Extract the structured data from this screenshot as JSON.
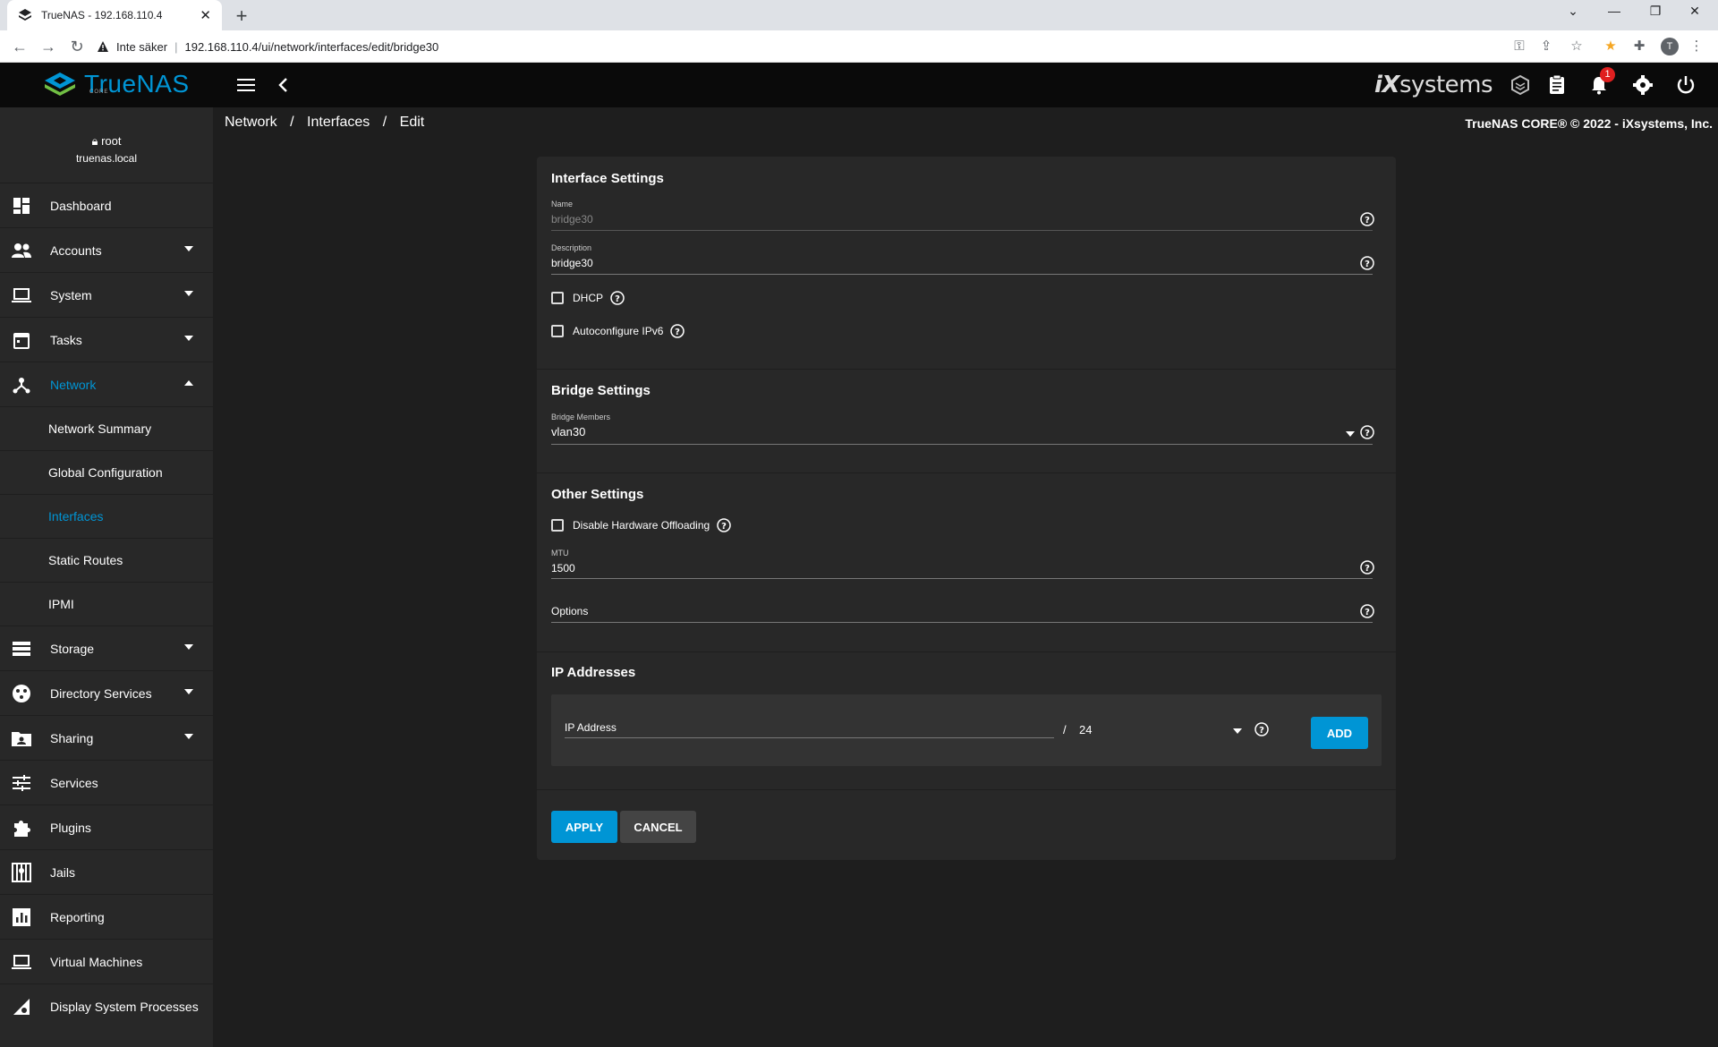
{
  "browser": {
    "tab_title": "TrueNAS - 192.168.110.4",
    "new_tab": "+",
    "insecure_label": "Inte säker",
    "separator": "|",
    "url": "192.168.110.4/ui/network/interfaces/edit/bridge30",
    "profile_initial": "T"
  },
  "topbar": {
    "logo_text": "TrueNAS",
    "logo_sub": "CORE",
    "vendor_logo": "iXsystems",
    "vendor_logo_ix": "iX",
    "vendor_logo_rest": "systems",
    "notification_count": "1"
  },
  "sidebar": {
    "user": "root",
    "host": "truenas.local",
    "items": [
      {
        "label": "Dashboard",
        "icon": "dashboard-icon",
        "expandable": false
      },
      {
        "label": "Accounts",
        "icon": "accounts-icon",
        "expandable": true
      },
      {
        "label": "System",
        "icon": "system-icon",
        "expandable": true
      },
      {
        "label": "Tasks",
        "icon": "tasks-icon",
        "expandable": true
      },
      {
        "label": "Network",
        "icon": "network-icon",
        "expandable": true,
        "expanded": true
      },
      {
        "label": "Storage",
        "icon": "storage-icon",
        "expandable": true
      },
      {
        "label": "Directory Services",
        "icon": "directory-icon",
        "expandable": true
      },
      {
        "label": "Sharing",
        "icon": "sharing-icon",
        "expandable": true
      },
      {
        "label": "Services",
        "icon": "services-icon",
        "expandable": false
      },
      {
        "label": "Plugins",
        "icon": "plugins-icon",
        "expandable": false
      },
      {
        "label": "Jails",
        "icon": "jails-icon",
        "expandable": false
      },
      {
        "label": "Reporting",
        "icon": "reporting-icon",
        "expandable": false
      },
      {
        "label": "Virtual Machines",
        "icon": "vm-icon",
        "expandable": false
      },
      {
        "label": "Display System Processes",
        "icon": "processes-icon",
        "expandable": false
      }
    ],
    "network_sub": [
      {
        "label": "Network Summary"
      },
      {
        "label": "Global Configuration"
      },
      {
        "label": "Interfaces",
        "active": true
      },
      {
        "label": "Static Routes"
      },
      {
        "label": "IPMI"
      }
    ]
  },
  "breadcrumb": {
    "items": [
      "Network",
      "Interfaces",
      "Edit"
    ],
    "separator": "/"
  },
  "copyright": "TrueNAS CORE® © 2022 - iXsystems, Inc.",
  "form": {
    "interface_settings_title": "Interface Settings",
    "name_label": "Name",
    "name_value": "bridge30",
    "description_label": "Description",
    "description_value": "bridge30",
    "dhcp_label": "DHCP",
    "ipv6_label": "Autoconfigure IPv6",
    "bridge_settings_title": "Bridge Settings",
    "bridge_members_label": "Bridge Members",
    "bridge_members_value": "vlan30",
    "other_settings_title": "Other Settings",
    "disable_offload_label": "Disable Hardware Offloading",
    "mtu_label": "MTU",
    "mtu_value": "1500",
    "options_placeholder": "Options",
    "ip_title": "IP Addresses",
    "ip_placeholder": "IP Address",
    "ip_slash": "/",
    "ip_mask": "24",
    "add_label": "ADD",
    "apply_label": "APPLY",
    "cancel_label": "CANCEL"
  },
  "colors": {
    "accent": "#0095d5",
    "background": "#1e1e1e",
    "panel": "#282828",
    "topbar": "#0a0a0a",
    "badge": "#e02020"
  }
}
